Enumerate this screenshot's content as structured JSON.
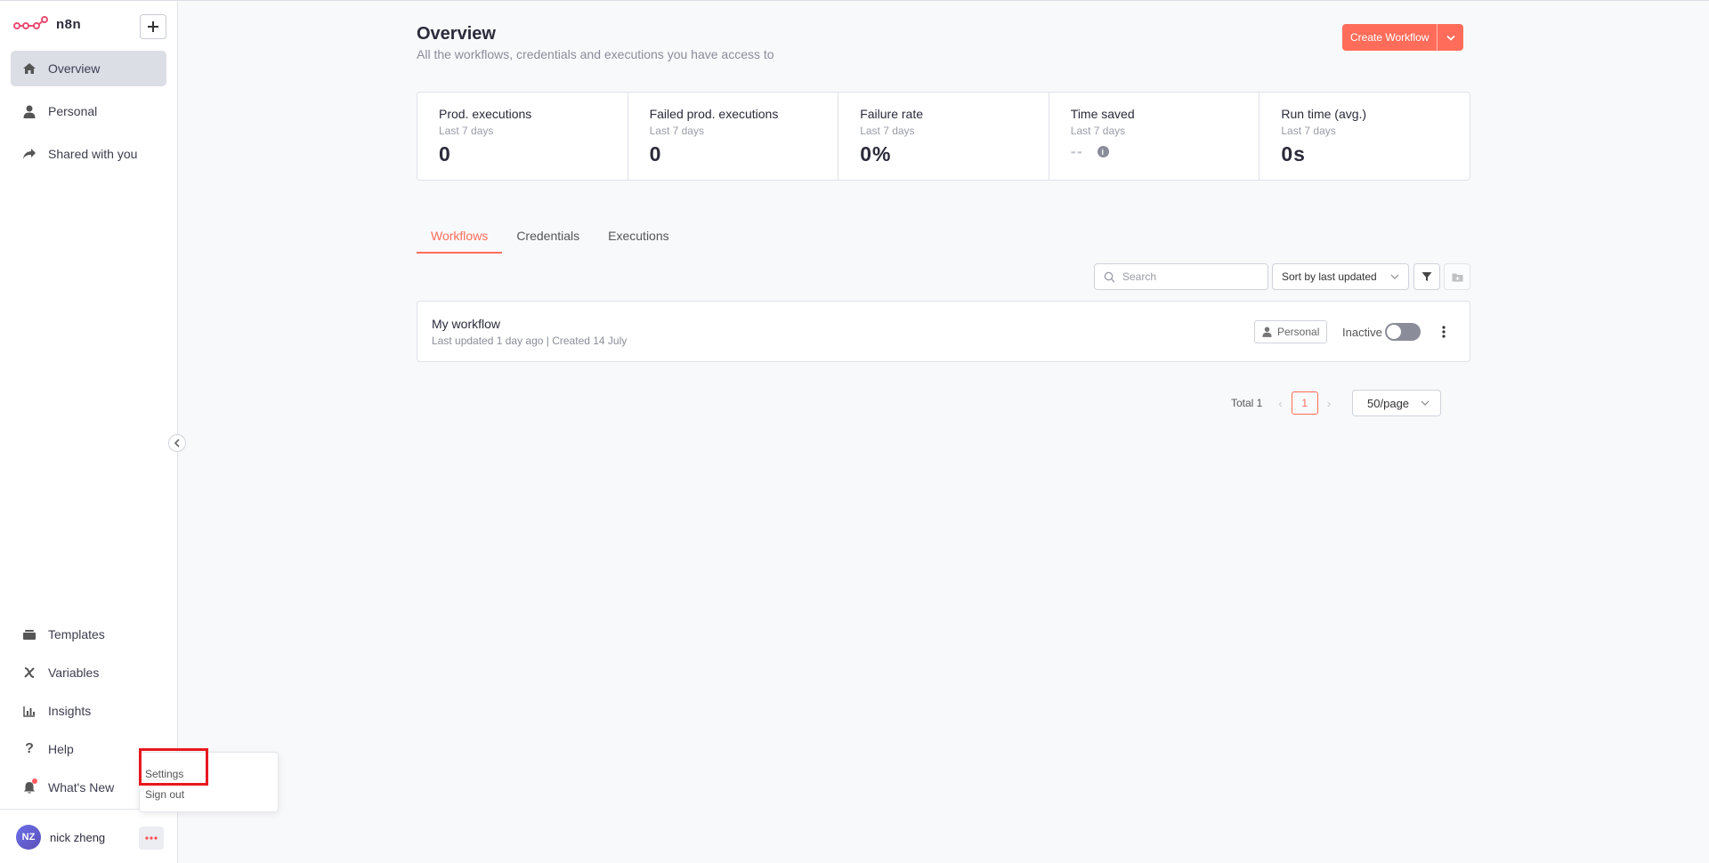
{
  "app": {
    "logo_text": "n8n"
  },
  "sidebar": {
    "items": [
      {
        "label": "Overview",
        "icon": "home-icon",
        "active": true
      },
      {
        "label": "Personal",
        "icon": "user-icon"
      },
      {
        "label": "Shared with you",
        "icon": "share-icon"
      }
    ],
    "bottom_items": [
      {
        "label": "Templates",
        "icon": "templates-icon"
      },
      {
        "label": "Variables",
        "icon": "variables-icon"
      },
      {
        "label": "Insights",
        "icon": "insights-icon"
      },
      {
        "label": "Help",
        "icon": "help-icon"
      },
      {
        "label": "What's New",
        "icon": "bell-icon"
      }
    ],
    "user": {
      "initials": "NZ",
      "name": "nick zheng"
    }
  },
  "popup_menu": {
    "items": [
      "Settings",
      "Sign out"
    ]
  },
  "header": {
    "title": "Overview",
    "subtitle": "All the workflows, credentials and executions you have access to",
    "create_button": "Create Workflow"
  },
  "stats": [
    {
      "title": "Prod. executions",
      "period": "Last 7 days",
      "value": "0"
    },
    {
      "title": "Failed prod. executions",
      "period": "Last 7 days",
      "value": "0"
    },
    {
      "title": "Failure rate",
      "period": "Last 7 days",
      "value": "0%"
    },
    {
      "title": "Time saved",
      "period": "Last 7 days",
      "value": "--"
    },
    {
      "title": "Run time (avg.)",
      "period": "Last 7 days",
      "value": "0s"
    }
  ],
  "tabs": [
    "Workflows",
    "Credentials",
    "Executions"
  ],
  "toolbar": {
    "search_placeholder": "Search",
    "sort_label": "Sort by last updated"
  },
  "workflows": [
    {
      "name": "My workflow",
      "meta": "Last updated 1 day ago | Created 14 July",
      "tag": "Personal",
      "status": "Inactive"
    }
  ],
  "pagination": {
    "total_label": "Total 1",
    "current_page": "1",
    "per_page": "50/page"
  },
  "colors": {
    "accent": "#ff6d5a",
    "highlight": "#e8181e"
  }
}
